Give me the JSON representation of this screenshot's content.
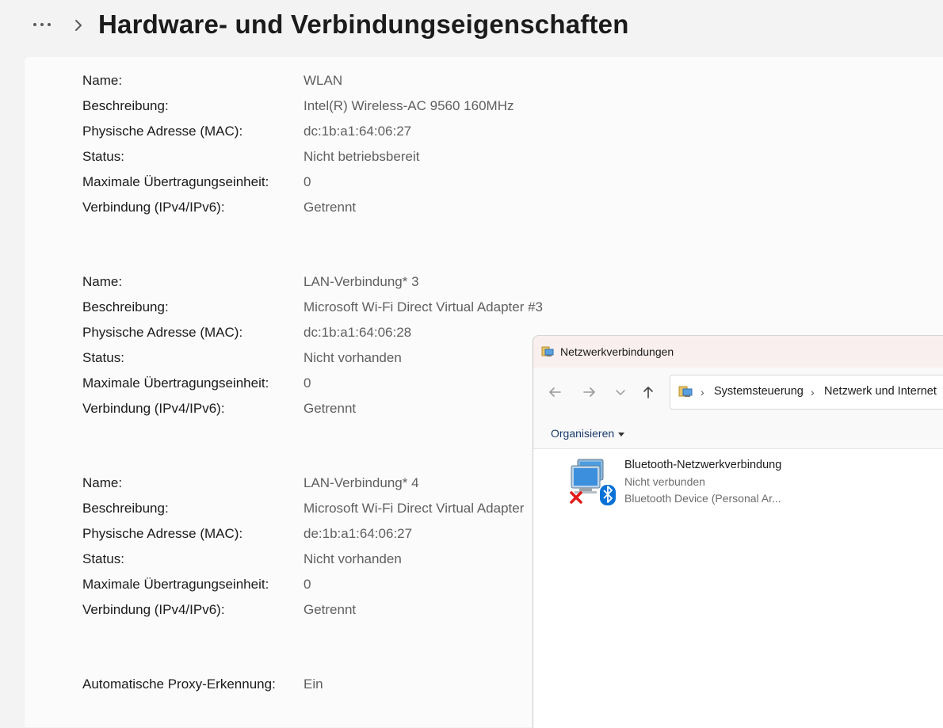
{
  "header": {
    "title": "Hardware- und Verbindungseigenschaften"
  },
  "adapters": [
    {
      "name_label": "Name:",
      "name": "WLAN",
      "desc_label": "Beschreibung:",
      "desc": "Intel(R) Wireless-AC 9560 160MHz",
      "mac_label": "Physische Adresse (MAC):",
      "mac": "dc:1b:a1:64:06:27",
      "status_label": "Status:",
      "status": "Nicht betriebsbereit",
      "mtu_label": "Maximale Übertragungseinheit:",
      "mtu": "0",
      "conn_label": "Verbindung (IPv4/IPv6):",
      "conn": "Getrennt"
    },
    {
      "name_label": "Name:",
      "name": "LAN-Verbindung* 3",
      "desc_label": "Beschreibung:",
      "desc": "Microsoft Wi-Fi Direct Virtual Adapter #3",
      "mac_label": "Physische Adresse (MAC):",
      "mac": "dc:1b:a1:64:06:28",
      "status_label": "Status:",
      "status": "Nicht vorhanden",
      "mtu_label": "Maximale Übertragungseinheit:",
      "mtu": "0",
      "conn_label": "Verbindung (IPv4/IPv6):",
      "conn": "Getrennt"
    },
    {
      "name_label": "Name:",
      "name": "LAN-Verbindung* 4",
      "desc_label": "Beschreibung:",
      "desc": "Microsoft Wi-Fi Direct Virtual Adapter",
      "mac_label": "Physische Adresse (MAC):",
      "mac": "de:1b:a1:64:06:27",
      "status_label": "Status:",
      "status": "Nicht vorhanden",
      "mtu_label": "Maximale Übertragungseinheit:",
      "mtu": "0",
      "conn_label": "Verbindung (IPv4/IPv6):",
      "conn": "Getrennt"
    }
  ],
  "proxy": {
    "label": "Automatische Proxy-Erkennung:",
    "value": "Ein"
  },
  "explorer": {
    "title": "Netzwerkverbindungen",
    "breadcrumb": [
      "Systemsteuerung",
      "Netzwerk und Internet"
    ],
    "organize": "Organisieren",
    "item": {
      "name": "Bluetooth-Netzwerkverbindung",
      "status": "Nicht verbunden",
      "device": "Bluetooth Device (Personal Ar..."
    },
    "icons": [
      "network-connections-icon",
      "back-arrow-icon",
      "forward-arrow-icon",
      "recent-chevron-icon",
      "up-arrow-icon",
      "control-panel-icon",
      "network-adapter-icon",
      "bluetooth-icon",
      "disconnected-x-icon"
    ]
  },
  "colors": {
    "accent": "#0063b1",
    "bluetooth": "#0a72d6",
    "error": "#e21b1b",
    "titlebar": "#f9efee"
  }
}
